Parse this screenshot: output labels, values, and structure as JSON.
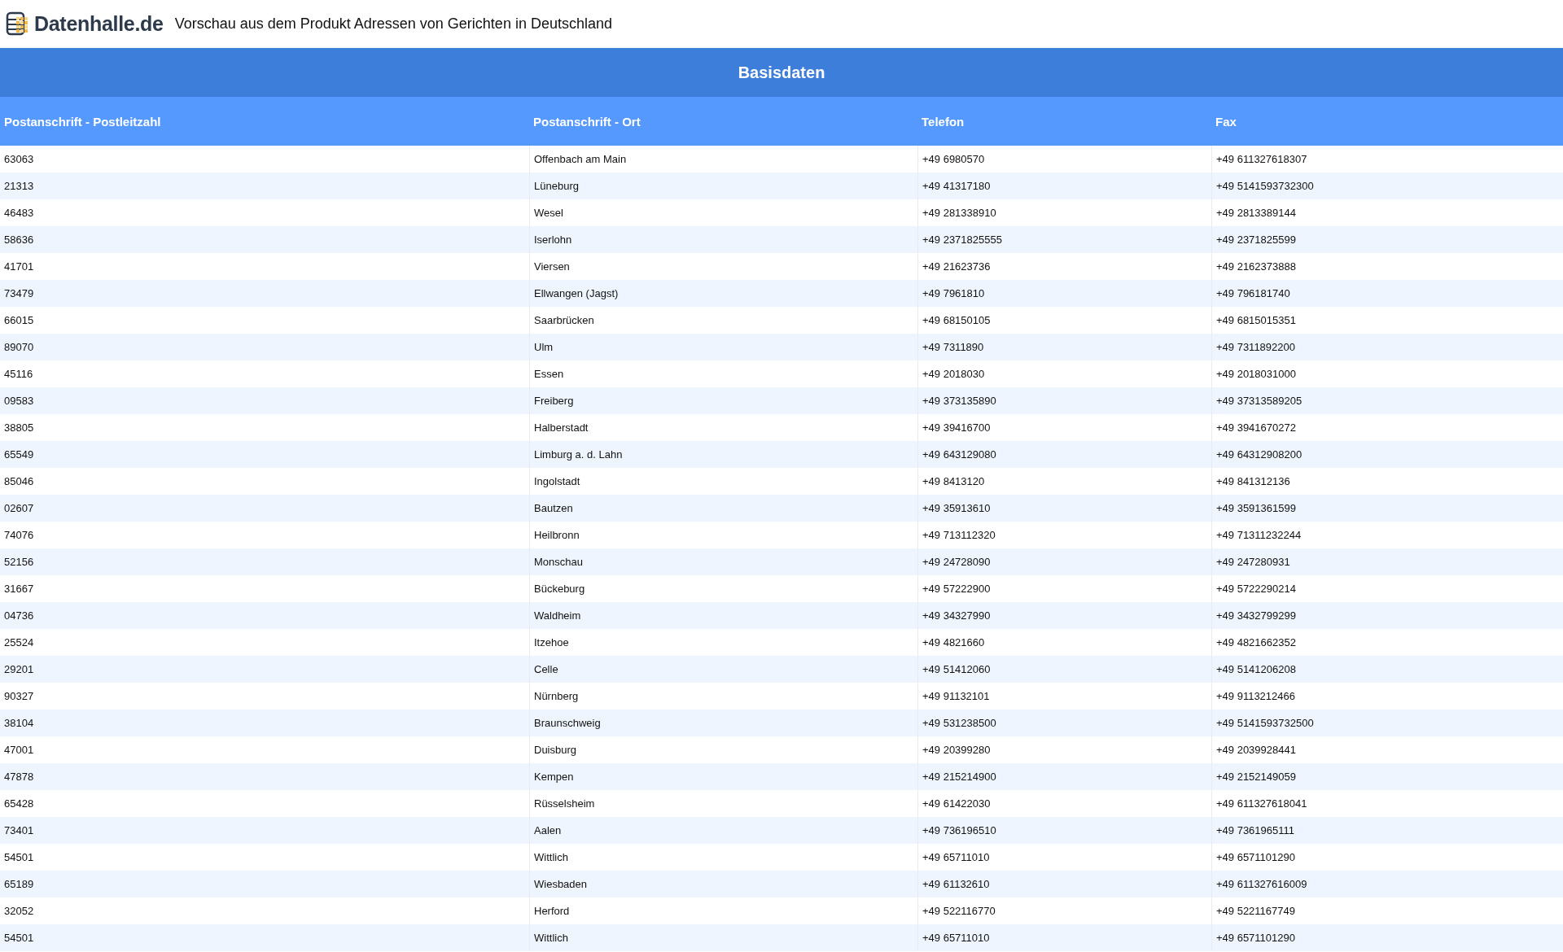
{
  "header": {
    "brand": "Datenhalle.de",
    "title": "Vorschau aus dem Produkt Adressen von Gerichten in Deutschland"
  },
  "table": {
    "caption": "Basisdaten",
    "columns": [
      "Postanschrift - Postleitzahl",
      "Postanschrift - Ort",
      "Telefon",
      "Fax"
    ],
    "rows": [
      [
        "63063",
        "Offenbach am Main",
        "+49 6980570",
        "+49 611327618307"
      ],
      [
        "21313",
        "Lüneburg",
        "+49 41317180",
        "+49 5141593732300"
      ],
      [
        "46483",
        "Wesel",
        "+49 281338910",
        "+49 2813389144"
      ],
      [
        "58636",
        "Iserlohn",
        "+49 2371825555",
        "+49 2371825599"
      ],
      [
        "41701",
        "Viersen",
        "+49 21623736",
        "+49 2162373888"
      ],
      [
        "73479",
        "Ellwangen (Jagst)",
        "+49 7961810",
        "+49 796181740"
      ],
      [
        "66015",
        "Saarbrücken",
        "+49 68150105",
        "+49 6815015351"
      ],
      [
        "89070",
        "Ulm",
        "+49 7311890",
        "+49 7311892200"
      ],
      [
        "45116",
        "Essen",
        "+49 2018030",
        "+49 2018031000"
      ],
      [
        "09583",
        "Freiberg",
        "+49 373135890",
        "+49 37313589205"
      ],
      [
        "38805",
        "Halberstadt",
        "+49 39416700",
        "+49 3941670272"
      ],
      [
        "65549",
        "Limburg a. d. Lahn",
        "+49 643129080",
        "+49 64312908200"
      ],
      [
        "85046",
        "Ingolstadt",
        "+49 8413120",
        "+49 841312136"
      ],
      [
        "02607",
        "Bautzen",
        "+49 35913610",
        "+49 3591361599"
      ],
      [
        "74076",
        "Heilbronn",
        "+49 713112320",
        "+49 71311232244"
      ],
      [
        "52156",
        "Monschau",
        "+49 24728090",
        "+49 247280931"
      ],
      [
        "31667",
        "Bückeburg",
        "+49 57222900",
        "+49 5722290214"
      ],
      [
        "04736",
        "Waldheim",
        "+49 34327990",
        "+49 3432799299"
      ],
      [
        "25524",
        "Itzehoe",
        "+49 4821660",
        "+49 4821662352"
      ],
      [
        "29201",
        "Celle",
        "+49 51412060",
        "+49 5141206208"
      ],
      [
        "90327",
        "Nürnberg",
        "+49 91132101",
        "+49 9113212466"
      ],
      [
        "38104",
        "Braunschweig",
        "+49 531238500",
        "+49 5141593732500"
      ],
      [
        "47001",
        "Duisburg",
        "+49 20399280",
        "+49 2039928441"
      ],
      [
        "47878",
        "Kempen",
        "+49 215214900",
        "+49 2152149059"
      ],
      [
        "65428",
        "Rüsselsheim",
        "+49 61422030",
        "+49 611327618041"
      ],
      [
        "73401",
        "Aalen",
        "+49 736196510",
        "+49 7361965111"
      ],
      [
        "54501",
        "Wittlich",
        "+49 65711010",
        "+49 6571101290"
      ],
      [
        "65189",
        "Wiesbaden",
        "+49 61132610",
        "+49 611327616009"
      ],
      [
        "32052",
        "Herford",
        "+49 522116770",
        "+49 5221167749"
      ],
      [
        "54501",
        "Wittlich",
        "+49 65711010",
        "+49 6571101290"
      ]
    ]
  }
}
